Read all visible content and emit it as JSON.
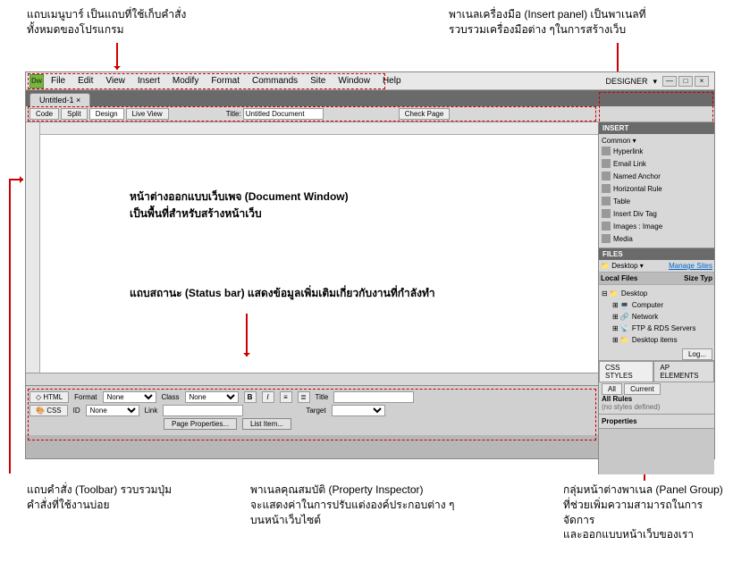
{
  "annotations": {
    "menubar": "แถบเมนูบาร์ เป็นแถบที่ใช้เก็บคำสั่ง\nทั้งหมดของโปรแกรม",
    "insert_panel": "พาเนลเครื่องมือ (Insert panel) เป็นพาเนลที่\nรวบรวมเครื่องมือต่าง ๆในการสร้างเว็บ",
    "doc_window": "หน้าต่างออกแบบเว็บเพจ (Document Window)\nเป็นพื้นที่สำหรับสร้างหน้าเว็บ",
    "status_bar": "แถบสถานะ (Status bar) แสดงข้อมูลเพิ่มเติมเกี่ยวกับงานที่กำลังทำ",
    "toolbar": "แถบคำสั่ง (Toolbar) รวบรวมปุ่ม\nคำสั่งที่ใช้งานบ่อย",
    "prop_insp": "พาเนลคุณสมบัติ (Property Inspector)\nจะแสดงค่าในการปรับแต่งองค์ประกอบต่าง ๆ\nบนหน้าเว็บไซต์",
    "panel_group": "กลุ่มหน้าต่างพาเนล (Panel Group)\nที่ช่วยเพิ่มความสามารถในการจัดการ\nและออกแบบหน้าเว็บของเรา"
  },
  "app": {
    "dw": "Dw",
    "menu": [
      "File",
      "Edit",
      "View",
      "Insert",
      "Modify",
      "Format",
      "Commands",
      "Site",
      "Window",
      "Help"
    ],
    "designer": "DESIGNER",
    "tab": "Untitled-1",
    "toolbar": {
      "code": "Code",
      "split": "Split",
      "design": "Design",
      "live_view": "Live View",
      "title_lbl": "Title:",
      "title_val": "Untitled Document",
      "check": "Check Page"
    },
    "prop": {
      "html": "HTML",
      "css": "CSS",
      "format_lbl": "Format",
      "format_val": "None",
      "id_lbl": "ID",
      "id_val": "None",
      "class_lbl": "Class",
      "class_val": "None",
      "link_lbl": "Link",
      "title_lbl": "Title",
      "target_lbl": "Target",
      "page_props": "Page Properties...",
      "list_item": "List Item..."
    },
    "insert_panel": {
      "hdr": "INSERT",
      "grp": "Common",
      "items": [
        "Hyperlink",
        "Email Link",
        "Named Anchor",
        "Horizontal Rule",
        "Table",
        "Insert Div Tag",
        "Images : Image",
        "Media"
      ]
    },
    "files_panel": {
      "hdr": "FILES",
      "src": "Desktop",
      "manage": "Manage Sites",
      "cols_lbl": "Local Files",
      "cols_sz": "Size",
      "cols_ty": "Typ",
      "tree": [
        "Desktop",
        "Computer",
        "Network",
        "FTP & RDS Servers",
        "Desktop items"
      ],
      "log": "Log..."
    },
    "css_panel": {
      "tab1": "CSS STYLES",
      "tab2": "AP ELEMENTS",
      "all": "All",
      "current": "Current",
      "rules": "All Rules",
      "none": "(no styles defined)"
    },
    "props_panel": "Properties"
  }
}
